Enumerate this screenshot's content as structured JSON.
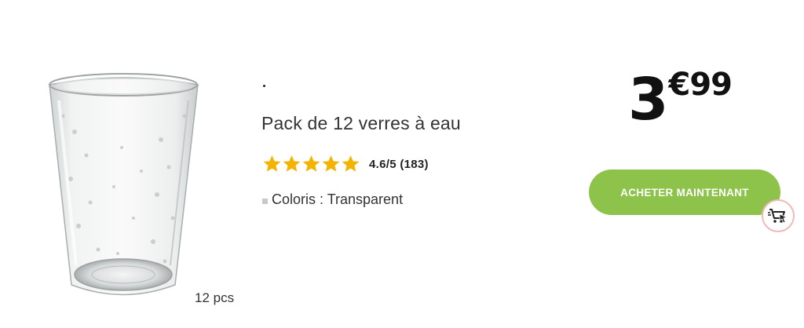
{
  "product": {
    "title": "Pack de 12 verres à eau",
    "image_alt": "water-glass-image",
    "quantity_label": "12 pcs",
    "rating": {
      "value": 4.6,
      "stars_filled": 5,
      "text": "4.6/5 (183)",
      "star_color": "#f5b301"
    },
    "color": {
      "label": "Coloris : Transparent"
    }
  },
  "price": {
    "integer": "3",
    "decimal": "€99"
  },
  "actions": {
    "buy_label": "ACHETER MAINTENANT",
    "buy_color": "#8dc24b",
    "cart_icon": "cart-cursor-icon"
  }
}
